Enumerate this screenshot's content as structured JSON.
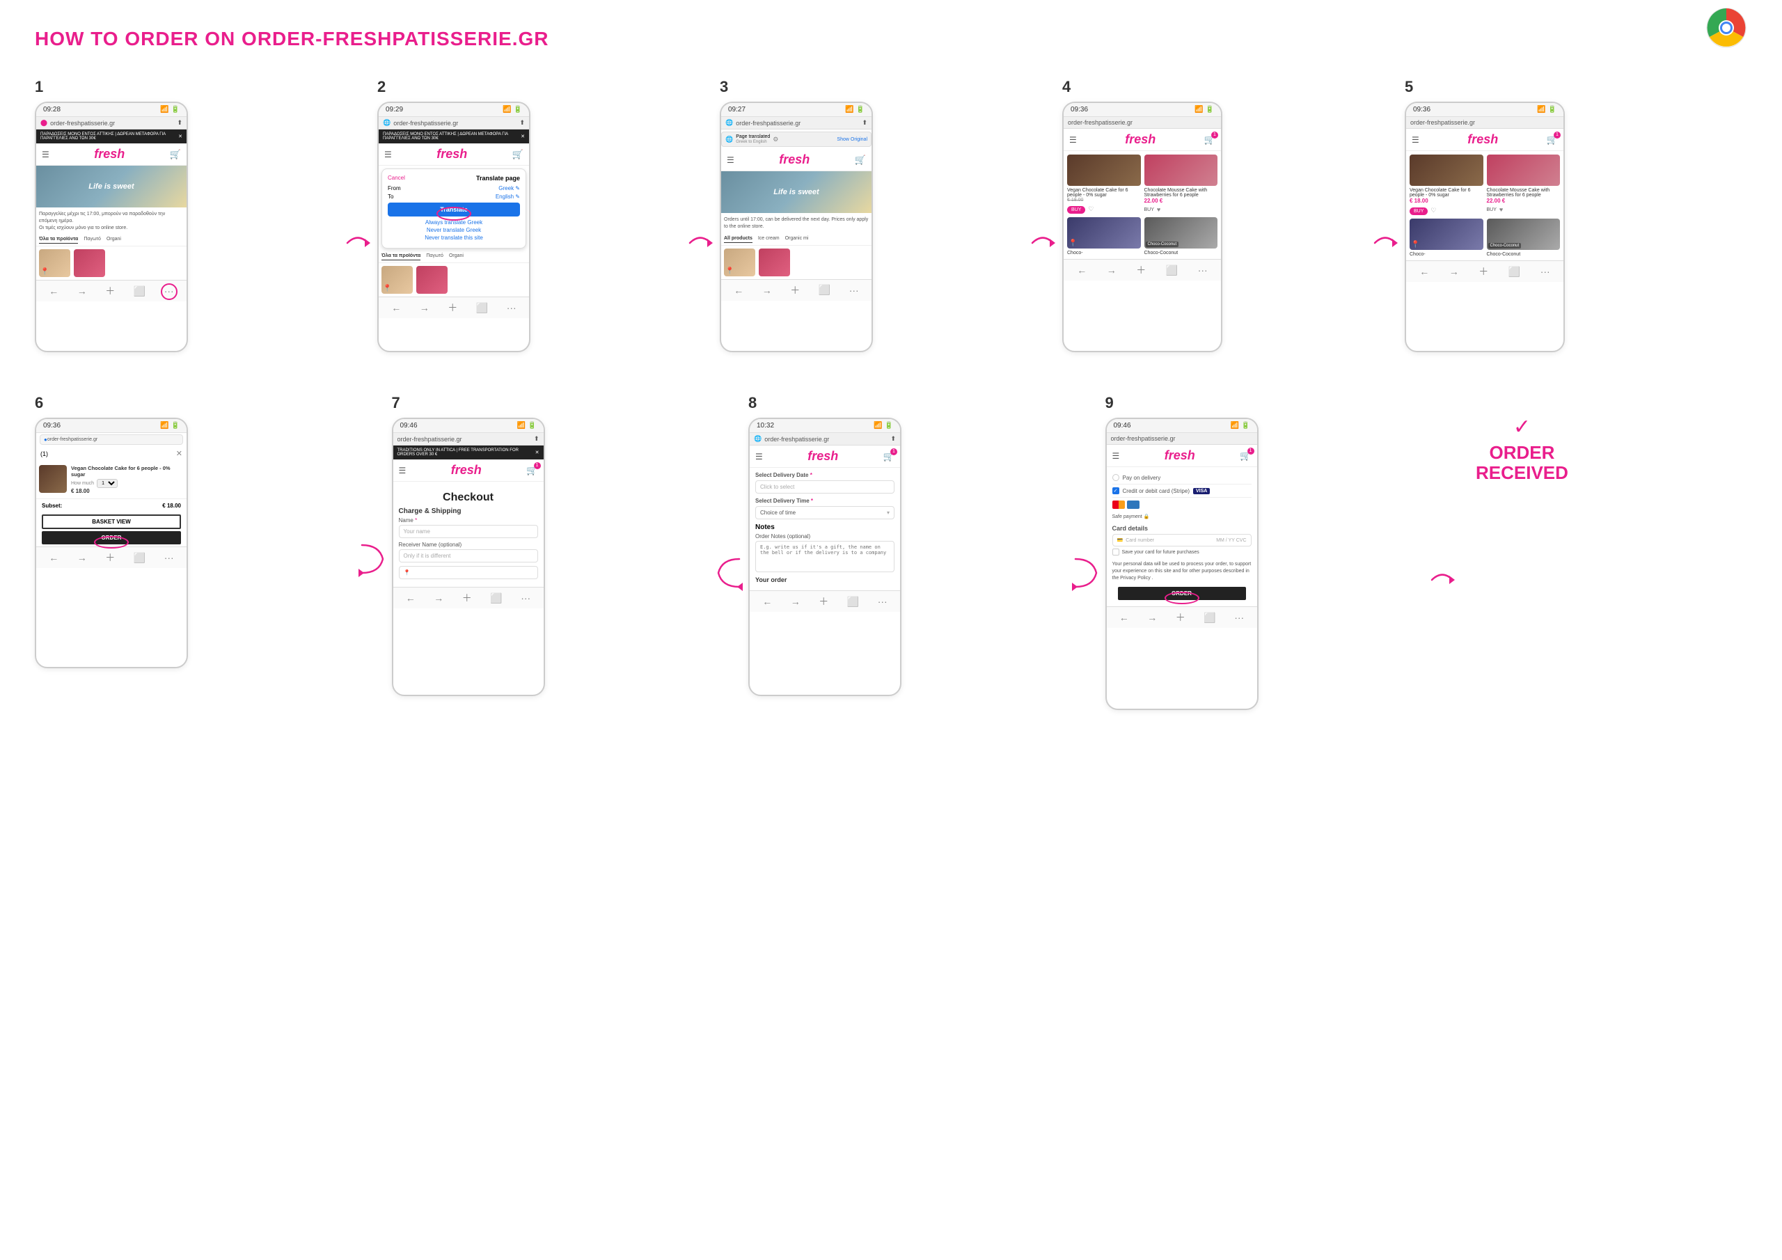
{
  "page": {
    "title": "HOW TO ORDER ON ORDER-FRESHPATISSERIE.GR"
  },
  "steps": [
    {
      "number": "1",
      "time": "09:28",
      "url": "order-freshpatisserie.gr",
      "banner": "ΠΑΡΑΔΟΣΕΙΣ ΜΟΝΟ ΕΝΤΟΣ ΑΤΤΙΚΗΣ | ΔΩΡΕΑΝ ΜΕΤΑΦΟΡΑ ΓΙΑ ΠΑΡΑΓΓΕΛΙΕΣ ΑΝΩ ΤΩΝ 30€",
      "brand": "fresh",
      "hero_text": "Life is sweet",
      "desc": "Παραγγελίες μέχρι τις 17:00, μπορούν να παραδοθούν την επόμενη ημέρα. Οι τιμές ισχύουν μόνο για το online store.",
      "tabs": [
        "Όλα τα προϊόντα",
        "Παγωτό",
        "Organi"
      ],
      "highlight": "address_bar"
    },
    {
      "number": "2",
      "time": "09:29",
      "url": "order-freshpatisserie.gr",
      "banner": "ΠΑΡΑΔΟΣΕΙΣ ΜΟΝΟ ΕΝΤΟΣ ΑΤΤΙΚΗΣ | ΔΩΡΕΑΝ ΜΕΤΑΦΟΡΑ ΓΙΑ ΠΑΡΑΓΓΕΛΙΕΣ ΑΝΩ ΤΩΝ 30€",
      "brand": "fresh",
      "translate_popup": {
        "cancel": "Cancel",
        "title": "Translate page",
        "from_label": "From",
        "from_value": "Greek",
        "to_label": "To",
        "to_value": "English",
        "translate_btn": "Translate",
        "always": "Always translate Greek",
        "never": "Never translate Greek",
        "never_site": "Never translate this site"
      },
      "tabs": [
        "Όλα τα προϊόντα",
        "Παγωτό",
        "Organi"
      ]
    },
    {
      "number": "3",
      "time": "09:27",
      "url": "order-freshpatisserie.gr",
      "translated_bar": {
        "text": "Page translated",
        "sub": "Greek to English",
        "show_original": "Show Original"
      },
      "brand": "fresh",
      "hero_text": "Life is sweet",
      "desc": "Orders until 17:00, can be delivered the next day. Prices only apply to the online store.",
      "tabs": [
        "All products",
        "Ice cream",
        "Organic mi"
      ]
    },
    {
      "number": "4",
      "time": "09:36",
      "url": "order-freshpatisserie.gr",
      "brand": "fresh",
      "products": [
        {
          "name": "Vegan Chocolate Cake for 6 people - 0% sugar",
          "old_price": "€ 18.00",
          "type": "vegan",
          "has_buy": true
        },
        {
          "name": "Chocolate Mousse Cake with Strawberries for 6 people",
          "price": "22.00 €",
          "type": "straw",
          "has_buy": false
        },
        {
          "name": "Choco-",
          "type": "choco",
          "has_buy": false
        },
        {
          "name": "Choco-Coconut",
          "type": "choco-coconut",
          "has_buy": false
        }
      ]
    },
    {
      "number": "5",
      "time": "09:36",
      "url": "order-freshpatisserie.gr",
      "brand": "fresh",
      "products": [
        {
          "name": "Vegan Chocolate Cake for 6 people - 0% sugar",
          "price": "€ 18.00",
          "type": "vegan",
          "has_buy": true
        },
        {
          "name": "Chocolate Mousse Cake with Strawberries for 6 people",
          "price": "22.00 €",
          "type": "straw",
          "has_buy": false
        },
        {
          "name": "Choco-",
          "type": "choco",
          "has_buy": false
        },
        {
          "name": "Choco-Coconut",
          "type": "choco-coconut",
          "has_buy": false
        }
      ]
    },
    {
      "number": "6",
      "time": "09:36",
      "url": "order-freshpatisserie.gr",
      "brand": "fresh",
      "cart": {
        "count": "(1)",
        "item_name": "Vegan Chocolate Cake for 6 people - 0% sugar",
        "qty_label": "How much",
        "qty_value": "1",
        "item_price": "€ 18.00",
        "subtotal_label": "Subset:",
        "subtotal_value": "€ 18.00",
        "basket_btn": "BASKET VIEW",
        "order_btn": "ORDER"
      }
    },
    {
      "number": "7",
      "time": "09:46",
      "url": "order-freshpatisserie.gr",
      "banner": "TRADITIONS ONLY IN ATTICA | FREE TRANSPORTATION FOR ORDERS OVER 30 €",
      "brand": "fresh",
      "checkout": {
        "title": "Checkout",
        "section": "Charge & Shipping",
        "name_label": "Name *",
        "name_placeholder": "Your name",
        "receiver_label": "Receiver Name (optional)",
        "receiver_placeholder": "Only if it is different"
      }
    },
    {
      "number": "8",
      "time": "10:32",
      "url": "order-freshpatisserie.gr",
      "brand": "fresh",
      "delivery": {
        "date_label": "Select Delivery Date *",
        "date_placeholder": "Click to select",
        "time_label": "Select Delivery Time *",
        "time_placeholder": "Choice of time",
        "notes_title": "Notes",
        "notes_label": "Order Notes (optional)",
        "notes_placeholder": "E.g. write us if it's a gift, the name on the bell or if the delivery is to a company",
        "your_order": "Your order"
      }
    },
    {
      "number": "9",
      "time": "09:46",
      "url": "order-freshpatisserie.gr",
      "brand": "fresh",
      "payment": {
        "pay_on_delivery": "Pay on delivery",
        "credit_card": "Credit or debit card (Stripe)",
        "safe_payment": "Safe payment 🔒",
        "card_details": "Card details",
        "card_number_placeholder": "Card number",
        "exp_placeholder": "MM / YY",
        "cvv_placeholder": "CVC",
        "save_card": "Save your card for future purchases",
        "privacy_text": "Your personal data will be used to process your order, to support your experience on this site and for other purposes described in the Privacy Policy .",
        "order_btn": "ORDER"
      },
      "order_received": {
        "checkmark": "✓",
        "title": "ORDER\nRECEIVED"
      }
    }
  ],
  "arrows": {
    "right": "➜",
    "curved": "↪"
  }
}
